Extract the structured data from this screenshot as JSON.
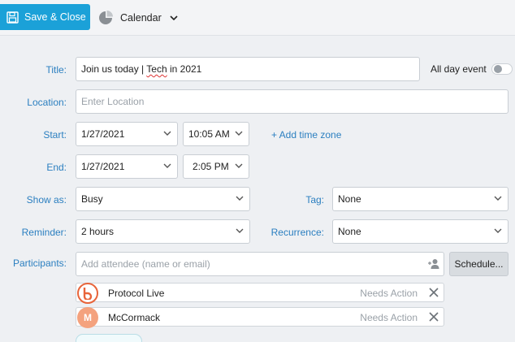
{
  "toolbar": {
    "save_label": "Save & Close",
    "calendar_label": "Calendar"
  },
  "form": {
    "title_label": "Title:",
    "title_value_part1": "Join us today | ",
    "title_value_part2": "Tech",
    "title_value_part3": " in 2021",
    "allday_label": "All day event",
    "location_label": "Location:",
    "location_placeholder": "Enter Location",
    "start_label": "Start:",
    "start_date": "1/27/2021",
    "start_time": "10:05 AM",
    "add_timezone": "+ Add time zone",
    "end_label": "End:",
    "end_date": "1/27/2021",
    "end_time": "2:05 PM",
    "showas_label": "Show as:",
    "showas_value": "Busy",
    "tag_label": "Tag:",
    "tag_value": "None",
    "reminder_label": "Reminder:",
    "reminder_value": "2 hours",
    "recurrence_label": "Recurrence:",
    "recurrence_value": "None",
    "participants_label": "Participants:",
    "participants_placeholder": "Add attendee (name or email)",
    "schedule_label": "Schedule..."
  },
  "attendees": [
    {
      "name": "Protocol Live",
      "status": "Needs Action",
      "avatar_letter": "",
      "avatar_color": "#ffffff",
      "ring_color": "#e8643a"
    },
    {
      "name": "McCormack",
      "status": "Needs Action",
      "avatar_letter": "M",
      "avatar_color": "#f4a27e"
    }
  ],
  "colors": {
    "accent": "#1ba1d8",
    "label": "#2b7fc0"
  }
}
